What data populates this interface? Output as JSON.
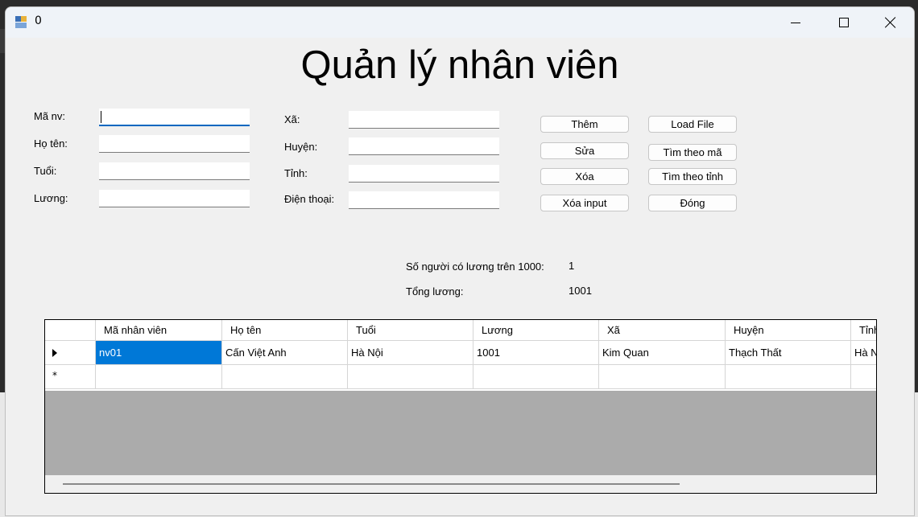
{
  "window": {
    "title": "0"
  },
  "heading": "Quản lý nhân viên",
  "form": {
    "left": [
      {
        "label": "Mã nv:",
        "value": ""
      },
      {
        "label": "Họ tên:",
        "value": ""
      },
      {
        "label": "Tuổi:",
        "value": ""
      },
      {
        "label": "Lương:",
        "value": ""
      }
    ],
    "right": [
      {
        "label": "Xã:",
        "value": ""
      },
      {
        "label": "Huyện:",
        "value": ""
      },
      {
        "label": "Tỉnh:",
        "value": ""
      },
      {
        "label": "Điện thoại:",
        "value": ""
      }
    ]
  },
  "buttons": {
    "add": "Thêm",
    "edit": "Sửa",
    "delete": "Xóa",
    "clear_input": "Xóa input",
    "load_file": "Load File",
    "search_by_id": "Tìm theo mã",
    "search_by_province": "Tìm theo tỉnh",
    "close": "Đóng"
  },
  "stats": {
    "count_label": "Số người có lương trên 1000:",
    "count_value": "1",
    "total_label": "Tổng lương:",
    "total_value": "1001"
  },
  "grid": {
    "columns": [
      "Mã nhân viên",
      "Họ tên",
      "Tuổi",
      "Lương",
      "Xã",
      "Huyện",
      "Tỉnh"
    ],
    "rows": [
      [
        "nv01",
        "Cấn Việt Anh",
        "Hà Nội",
        "1001",
        "Kim Quan",
        "Thạch Thất",
        "Hà Nội"
      ]
    ],
    "new_row_marker": "*"
  },
  "colors": {
    "selection": "#0078d7",
    "focus": "#0067c0"
  }
}
